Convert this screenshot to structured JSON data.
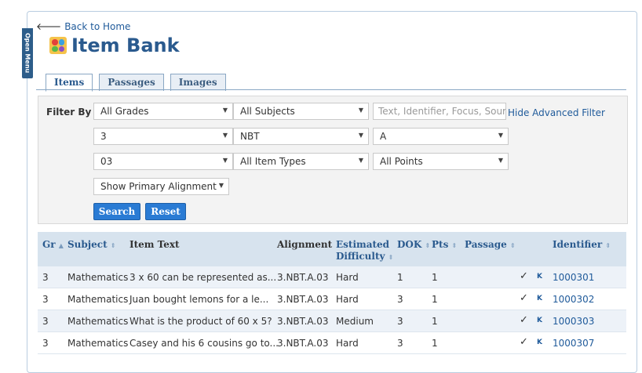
{
  "menu": {
    "open_label": "Open Menu"
  },
  "header": {
    "back_label": "Back to Home",
    "title": "Item Bank"
  },
  "tabs": [
    {
      "label": "Items",
      "active": true
    },
    {
      "label": "Passages",
      "active": false
    },
    {
      "label": "Images",
      "active": false
    }
  ],
  "filter": {
    "label": "Filter By",
    "grade": "All Grades",
    "subject": "All Subjects",
    "search_placeholder": "Text, Identifier, Focus, Source",
    "hide_advanced": "Hide Advanced Filter",
    "grade_level": "3",
    "domain": "NBT",
    "cluster": "A",
    "standard": "03",
    "item_types": "All Item Types",
    "points": "All Points",
    "alignment": "Show Primary Alignment",
    "search_button": "Search",
    "reset_button": "Reset"
  },
  "table": {
    "headers": {
      "grade": "Gr",
      "subject": "Subject",
      "item_text": "Item Text",
      "alignment": "Alignment",
      "difficulty_1": "Estimated",
      "difficulty_2": "Difficulty",
      "dok": "DOK",
      "pts": "Pts",
      "passage": "Passage",
      "identifier": "Identifier"
    },
    "rows": [
      {
        "grade": "3",
        "subject": "Mathematics",
        "text": "3 x 60 can be represented as...",
        "alignment": "3.NBT.A.03",
        "difficulty": "Hard",
        "dok": "1",
        "pts": "1",
        "check": "✓",
        "badge": "K",
        "identifier": "1000301"
      },
      {
        "grade": "3",
        "subject": "Mathematics",
        "text": "Juan bought lemons for a le...",
        "alignment": "3.NBT.A.03",
        "difficulty": "Hard",
        "dok": "3",
        "pts": "1",
        "check": "✓",
        "badge": "K",
        "identifier": "1000302"
      },
      {
        "grade": "3",
        "subject": "Mathematics",
        "text": "What is the product of 60 x 5?",
        "alignment": "3.NBT.A.03",
        "difficulty": "Medium",
        "dok": "3",
        "pts": "1",
        "check": "✓",
        "badge": "K",
        "identifier": "1000303"
      },
      {
        "grade": "3",
        "subject": "Mathematics",
        "text": "Casey and his 6 cousins go to...",
        "alignment": "3.NBT.A.03",
        "difficulty": "Hard",
        "dok": "3",
        "pts": "1",
        "check": "✓",
        "badge": "K",
        "identifier": "1000307"
      }
    ]
  },
  "colors": {
    "accent": "#2a5a8e",
    "button": "#2a7bd4",
    "header_bg": "#d7e3ee",
    "alt_row": "#edf2f8"
  }
}
